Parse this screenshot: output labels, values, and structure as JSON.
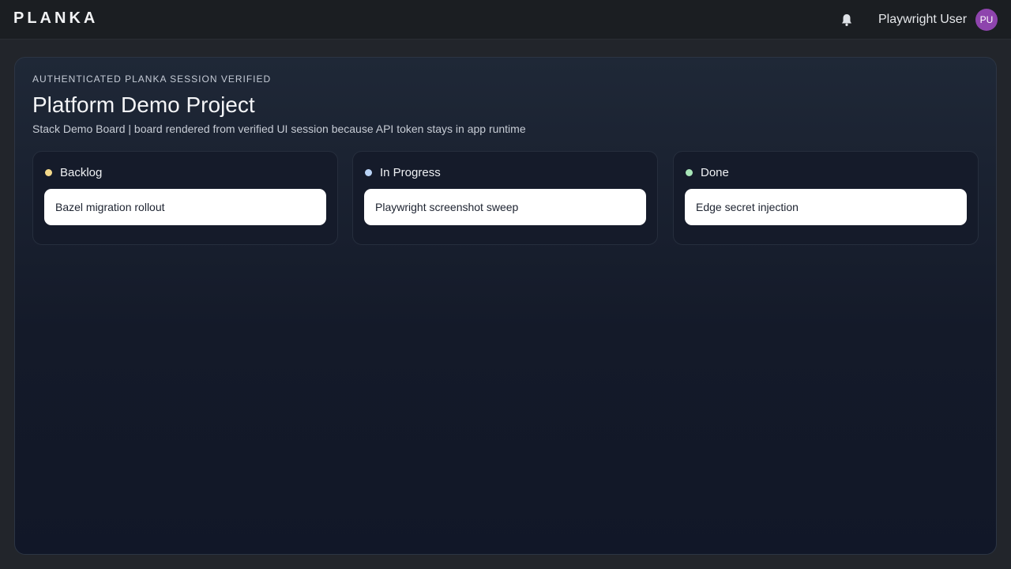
{
  "header": {
    "logo": "PLANKA",
    "notifications_icon": "bell-icon",
    "user_name": "Playwright User",
    "user_initials": "PU",
    "avatar_color": "#8e44ad"
  },
  "board": {
    "eyebrow": "AUTHENTICATED PLANKA SESSION VERIFIED",
    "project_title": "Platform Demo Project",
    "subtitle": "Stack Demo Board | board rendered from verified UI session because API token stays in app runtime"
  },
  "columns": [
    {
      "title": "Backlog",
      "dot_color": "#f3d98b",
      "cards": [
        "Bazel migration rollout"
      ]
    },
    {
      "title": "In Progress",
      "dot_color": "#b9d3f5",
      "cards": [
        "Playwright screenshot sweep"
      ]
    },
    {
      "title": "Done",
      "dot_color": "#a8e6b8",
      "cards": [
        "Edge secret injection"
      ]
    }
  ]
}
